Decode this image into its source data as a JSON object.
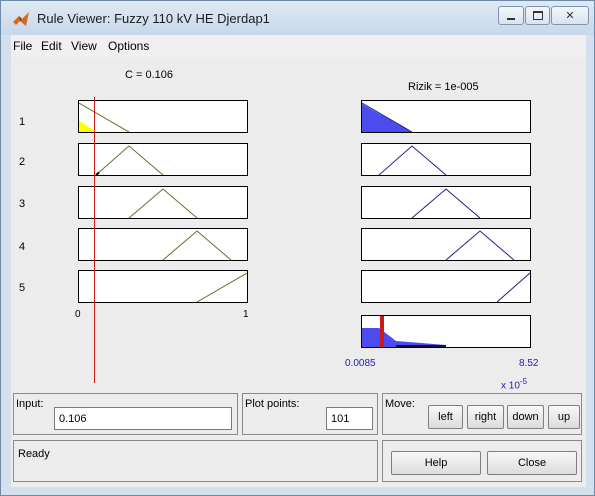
{
  "window": {
    "title": "Rule Viewer: Fuzzy 110 kV HE Djerdap1"
  },
  "menu": [
    "File",
    "Edit",
    "View",
    "Options"
  ],
  "input_plot": {
    "title": "C = 0.106",
    "axis_min": "0",
    "axis_max": "1",
    "value": 0.106
  },
  "output_plot": {
    "title": "Rizik = 1e-005",
    "axis_min": "0.0085",
    "axis_max": "8.52",
    "exponent_base": "x 10",
    "exponent_power": "-5"
  },
  "rules": [
    "1",
    "2",
    "3",
    "4",
    "5"
  ],
  "controls": {
    "input_label": "Input:",
    "input_value": "0.106",
    "plot_points_label": "Plot points:",
    "plot_points_value": "101",
    "move_label": "Move:",
    "left_label": "left",
    "right_label": "right",
    "down_label": "down",
    "up_label": "up",
    "status_text": "Ready",
    "help_label": "Help",
    "close_label": "Close"
  },
  "colors": {
    "input_fill": "#ffff00",
    "output_fill": "#4b4bf0",
    "input_line": "#6b6b2e",
    "output_line": "#1f1f8a",
    "indicator": "#cc1a1a"
  }
}
